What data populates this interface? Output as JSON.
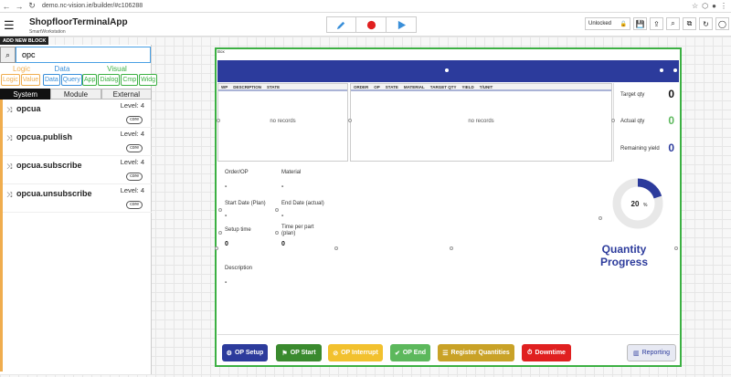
{
  "browser": {
    "url": "demo.nc-vision.ie/builder/#c106288"
  },
  "header": {
    "app_title": "ShopfloorTerminalApp",
    "app_subtitle": "SmartWorkstation",
    "lock_label": "Unlocked"
  },
  "left_panel": {
    "add_block_label": "ADD NEW BLOCK",
    "search_value": "opc",
    "categories": [
      {
        "title": "Logic",
        "color": "#f0ad4e",
        "buttons": [
          "Logic",
          "Value"
        ]
      },
      {
        "title": "Data",
        "color": "#3a8fd9",
        "buttons": [
          "Data",
          "Query"
        ]
      },
      {
        "title": "Visual",
        "color": "#3cb043",
        "buttons": [
          "App",
          "Dialog",
          "Cmp",
          "Widg"
        ]
      }
    ],
    "tabs": [
      "System",
      "Module",
      "External"
    ],
    "blocks": [
      {
        "name": "opcua",
        "level": "Level: 4",
        "badge": "core"
      },
      {
        "name": "opcua.publish",
        "level": "Level: 4",
        "badge": "core"
      },
      {
        "name": "opcua.subscribe",
        "level": "Level: 4",
        "badge": "core"
      },
      {
        "name": "opcua.unsubscribe",
        "level": "Level: 4",
        "badge": "core"
      }
    ]
  },
  "frame": {
    "label": "Box",
    "table_left": {
      "columns": [
        "WP",
        "DESCRIPTION",
        "STATE"
      ],
      "empty_text": "no records"
    },
    "table_right": {
      "columns": [
        "ORDER",
        "OP",
        "STATE",
        "MATERIAL",
        "TARGET QTY",
        "YIELD",
        "T/UNIT"
      ],
      "empty_text": "no records"
    },
    "kpis": [
      {
        "label": "Target qty",
        "value": "0",
        "color": "#111111"
      },
      {
        "label": "Actual qty",
        "value": "0",
        "color": "#5cb85c"
      },
      {
        "label": "Remaining yield",
        "value": "0",
        "color": "#2c3b9c"
      }
    ],
    "fields": {
      "order_op": {
        "label": "Order/OP",
        "value": "-"
      },
      "material": {
        "label": "Material",
        "value": "-"
      },
      "start_date": {
        "label": "Start Date (Plan)",
        "value": "-"
      },
      "end_date": {
        "label": "End Date (actual)",
        "value": "-"
      },
      "setup_time": {
        "label": "Setup time",
        "value": "0"
      },
      "time_per_part": {
        "label": "Time per part",
        "label2": "(plan)",
        "value": "0"
      },
      "description": {
        "label": "Description",
        "value": "-"
      }
    },
    "progress": {
      "percent": 20,
      "percent_label": "20",
      "percent_unit": "%",
      "title_line1": "Quantity",
      "title_line2": "Progress",
      "color": "#2c3b9c",
      "track_color": "#e8e8e8"
    },
    "buttons": [
      {
        "label": "OP Setup",
        "icon": "gear-icon",
        "color": "#2c3b9c"
      },
      {
        "label": "OP Start",
        "icon": "flag-icon",
        "color": "#3a8a2e"
      },
      {
        "label": "OP Interrupt",
        "icon": "pause-icon",
        "color": "#f2c12e"
      },
      {
        "label": "OP End",
        "icon": "check-icon",
        "color": "#5cb85c"
      },
      {
        "label": "Register Quantities",
        "icon": "list-icon",
        "color": "#c9a227"
      },
      {
        "label": "Downtime",
        "icon": "clock-icon",
        "color": "#e02020"
      }
    ],
    "reporting_label": "Reporting"
  }
}
